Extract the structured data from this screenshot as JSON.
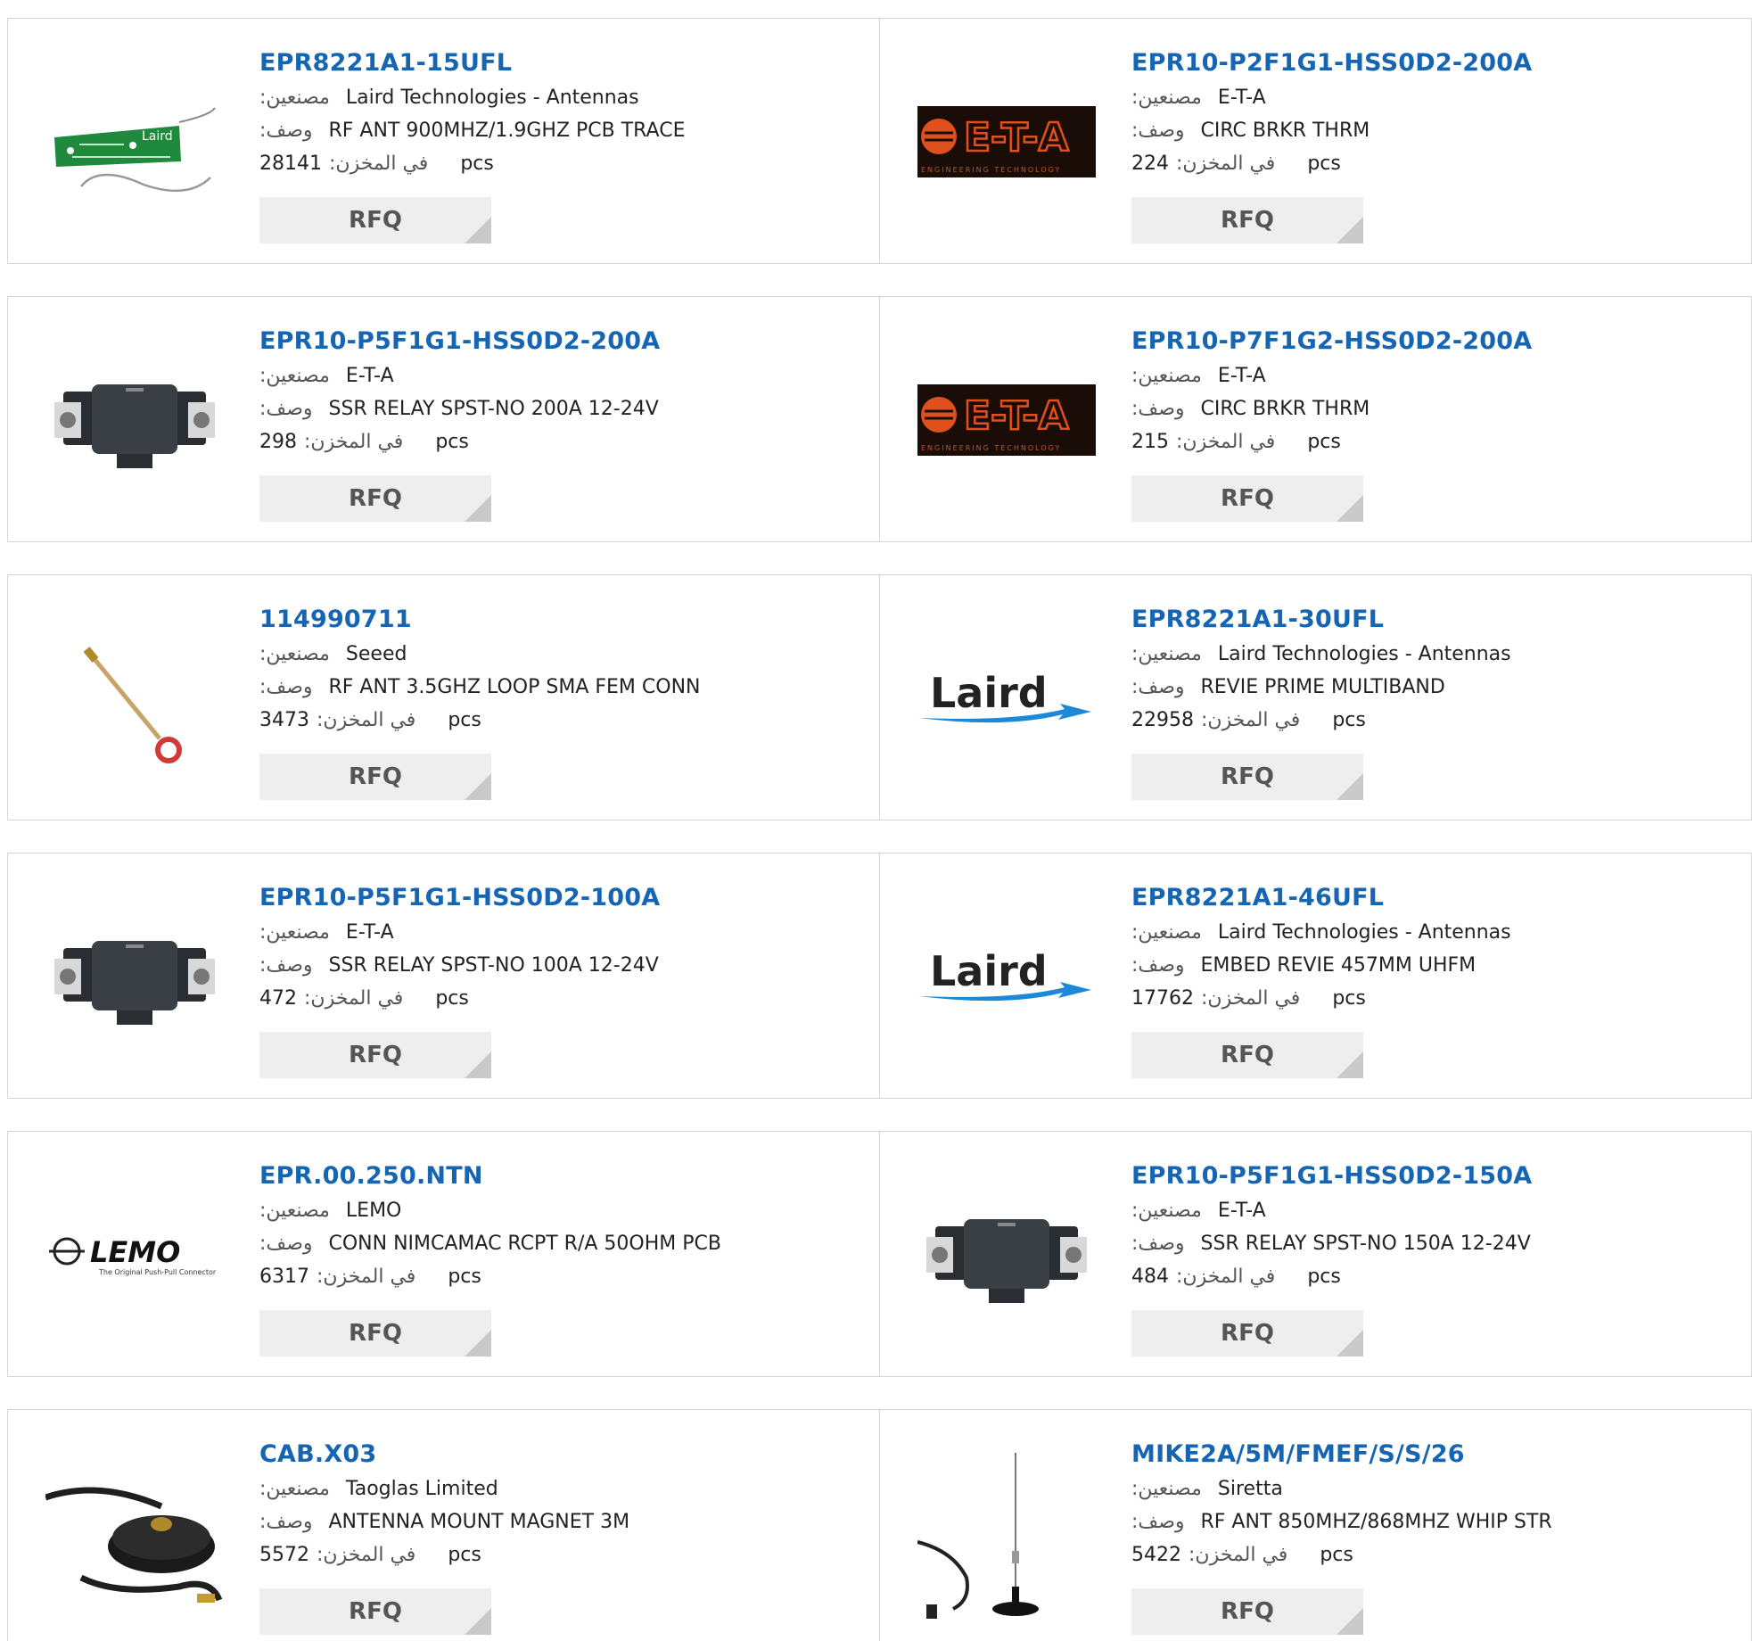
{
  "labels": {
    "manufacturer": ":مصنعين",
    "description": ":وصف",
    "stock": ":في المخزن",
    "unit": "pcs",
    "rfq": "RFQ"
  },
  "products": [
    {
      "part": "EPR8221A1-15UFL",
      "manufacturer": "Laird Technologies - Antennas",
      "description": "RF ANT 900MHZ/1.9GHZ PCB TRACE",
      "stock": "28141",
      "image": "laird-pcb-antenna",
      "logo_text": "Laird"
    },
    {
      "part": "EPR10-P2F1G1-HSS0D2-200A",
      "manufacturer": "E-T-A",
      "description": "CIRC BRKR THRM",
      "stock": "224",
      "image": "eta-logo",
      "logo_text": "E-T-A",
      "logo_sub": "ENGINEERING TECHNOLOGY"
    },
    {
      "part": "EPR10-P5F1G1-HSS0D2-200A",
      "manufacturer": "E-T-A",
      "description": "SSR RELAY SPST-NO 200A 12-24V",
      "stock": "298",
      "image": "ssr-relay"
    },
    {
      "part": "EPR10-P7F1G2-HSS0D2-200A",
      "manufacturer": "E-T-A",
      "description": "CIRC BRKR THRM",
      "stock": "215",
      "image": "eta-logo",
      "logo_text": "E-T-A",
      "logo_sub": "ENGINEERING TECHNOLOGY"
    },
    {
      "part": "114990711",
      "manufacturer": "Seeed",
      "description": "RF ANT 3.5GHZ LOOP SMA FEM CONN",
      "stock": "3473",
      "image": "loop-antenna"
    },
    {
      "part": "EPR8221A1-30UFL",
      "manufacturer": "Laird Technologies - Antennas",
      "description": "REVIE PRIME MULTIBAND",
      "stock": "22958",
      "image": "laird-logo",
      "logo_text": "Laird"
    },
    {
      "part": "EPR10-P5F1G1-HSS0D2-100A",
      "manufacturer": "E-T-A",
      "description": "SSR RELAY SPST-NO 100A 12-24V",
      "stock": "472",
      "image": "ssr-relay"
    },
    {
      "part": "EPR8221A1-46UFL",
      "manufacturer": "Laird Technologies - Antennas",
      "description": "EMBED REVIE 457MM UHFM",
      "stock": "17762",
      "image": "laird-logo",
      "logo_text": "Laird"
    },
    {
      "part": "EPR.00.250.NTN",
      "manufacturer": "LEMO",
      "description": "CONN NIMCAMAC RCPT R/A 50OHM PCB",
      "stock": "6317",
      "image": "lemo-logo",
      "logo_text": "LEMO",
      "logo_sub": "The Original Push-Pull Connector"
    },
    {
      "part": "EPR10-P5F1G1-HSS0D2-150A",
      "manufacturer": "E-T-A",
      "description": "SSR RELAY SPST-NO 150A 12-24V",
      "stock": "484",
      "image": "ssr-relay"
    },
    {
      "part": "CAB.X03",
      "manufacturer": "Taoglas Limited",
      "description": "ANTENNA MOUNT MAGNET 3M",
      "stock": "5572",
      "image": "magnet-mount"
    },
    {
      "part": "MIKE2A/5M/FMEF/S/S/26",
      "manufacturer": "Siretta",
      "description": "RF ANT 850MHZ/868MHZ WHIP STR",
      "stock": "5422",
      "image": "whip-antenna"
    }
  ]
}
